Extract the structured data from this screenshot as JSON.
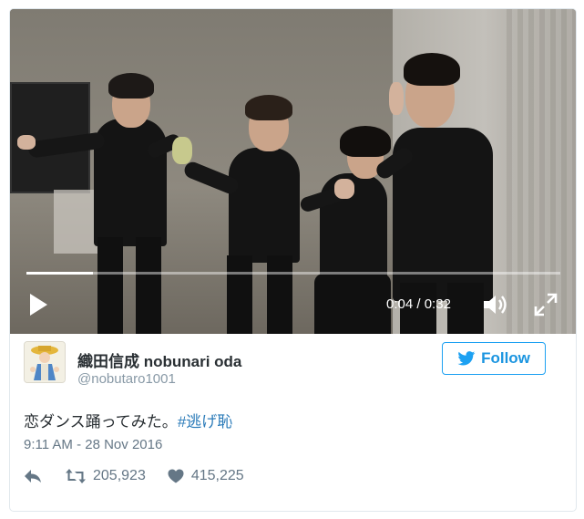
{
  "video": {
    "current_time": "0:04",
    "separator": "/",
    "duration": "0:32",
    "progress_fraction": 0.125
  },
  "tweet": {
    "display_name": "織田信成 nobunari oda",
    "handle": "@nobutaro1001",
    "follow_label": "Follow",
    "text": "恋ダンス踊ってみた。",
    "hashtag": "#逃げ恥",
    "timestamp": "9:11 AM - 28 Nov 2016",
    "retweets": "205,923",
    "likes": "415,225"
  },
  "icons": {
    "play": "play-icon",
    "volume": "volume-icon",
    "fullscreen": "fullscreen-icon",
    "bird": "twitter-bird-icon",
    "reply": "reply-icon",
    "retweet": "retweet-icon",
    "like": "heart-icon"
  },
  "colors": {
    "accent": "#1da1f2",
    "hashtag": "#2b7bb9",
    "muted": "#657786"
  }
}
